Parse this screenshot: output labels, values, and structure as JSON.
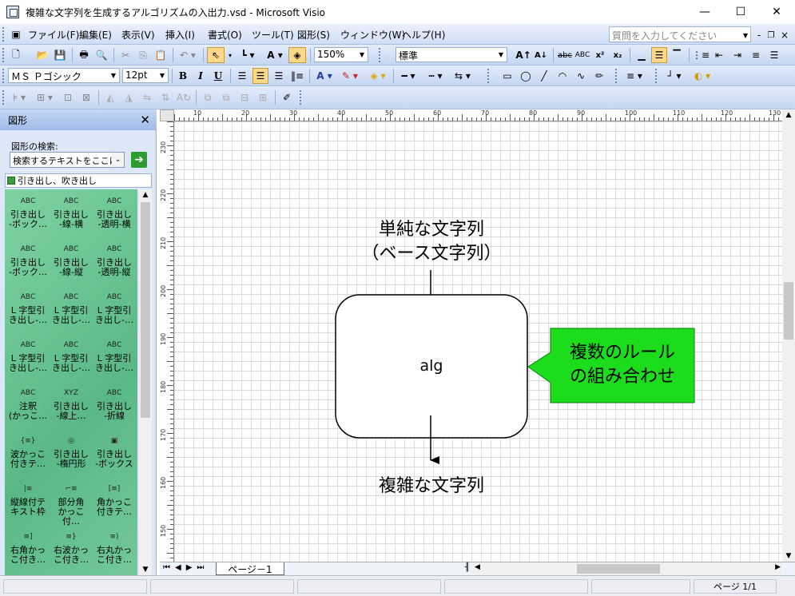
{
  "window": {
    "title": "複雑な文字列を生成するアルゴリズムの入出力.vsd - Microsoft Visio"
  },
  "menu": {
    "items": [
      "ファイル(F)",
      "編集(E)",
      "表示(V)",
      "挿入(I)",
      "書式(O)",
      "ツール(T)",
      "図形(S)",
      "ウィンドウ(W)",
      "ヘルプ(H)"
    ],
    "help_placeholder": "質問を入力してください"
  },
  "toolbar": {
    "zoom": "150%",
    "style": "標準",
    "font": "ＭＳ Ｐゴシック",
    "font_size": "12pt",
    "bold": "B",
    "italic": "I",
    "underline": "U"
  },
  "shapes_panel": {
    "title": "図形",
    "search_label": "図形の検索:",
    "search_placeholder": "検索するテキストをここに入",
    "stencil_name": "引き出し、吹き出し",
    "shapes": [
      [
        "引き出し",
        "-ボック…"
      ],
      [
        "引き出し",
        "-線-横"
      ],
      [
        "引き出し",
        "-透明-横"
      ],
      [
        "引き出し",
        "-ボック…"
      ],
      [
        "引き出し",
        "-線-縦"
      ],
      [
        "引き出し",
        "-透明-縦"
      ],
      [
        "L 字型引",
        "き出し-…"
      ],
      [
        "L 字型引",
        "き出し-…"
      ],
      [
        "L 字型引",
        "き出し-…"
      ],
      [
        "L 字型引",
        "き出し-…"
      ],
      [
        "L 字型引",
        "き出し-…"
      ],
      [
        "L 字型引",
        "き出し-…"
      ],
      [
        "注釈",
        "(かっこ…"
      ],
      [
        "引き出し",
        "-線上…"
      ],
      [
        "引き出し",
        "-折線"
      ],
      [
        "波かっこ",
        "付きテ…"
      ],
      [
        "引き出し",
        "-楕円形"
      ],
      [
        "引き出し",
        "-ボックス"
      ],
      [
        "縦線付テ",
        "キスト枠"
      ],
      [
        "部分角",
        "かっこ付…"
      ],
      [
        "角かっこ",
        "付きテ…"
      ],
      [
        "右角かっ",
        "こ付き…"
      ],
      [
        "右波かっ",
        "こ付き…"
      ],
      [
        "右丸かっ",
        "こ付き…"
      ]
    ],
    "icons": [
      "ABC",
      "ABC",
      "ABC",
      "ABC",
      "ABC",
      "ABC",
      "ABC",
      "ABC",
      "ABC",
      "ABC",
      "ABC",
      "ABC",
      "ABC",
      "XYZ",
      "ABC",
      "{≡}",
      "◎",
      "▣",
      "|≡",
      "⌐≡",
      "[≡]",
      "≡]",
      "≡}",
      "≡)"
    ]
  },
  "ruler": {
    "h_ticks": [
      "10",
      "20",
      "30",
      "40",
      "50",
      "60",
      "70",
      "80",
      "90",
      "100",
      "110",
      "120",
      "130"
    ],
    "v_ticks": [
      "230",
      "220",
      "210",
      "200",
      "190",
      "180",
      "170",
      "160",
      "150"
    ]
  },
  "diagram": {
    "input_line1": "単純な文字列",
    "input_line2": "（ベース文字列）",
    "process": "alg",
    "callout_line1": "複数のルール",
    "callout_line2": "の組み合わせ",
    "output": "複雑な文字列",
    "callout_color": "#1bdd1b"
  },
  "page_tabs": {
    "current": "ページ－1"
  },
  "status": {
    "page": "ページ 1/1"
  }
}
